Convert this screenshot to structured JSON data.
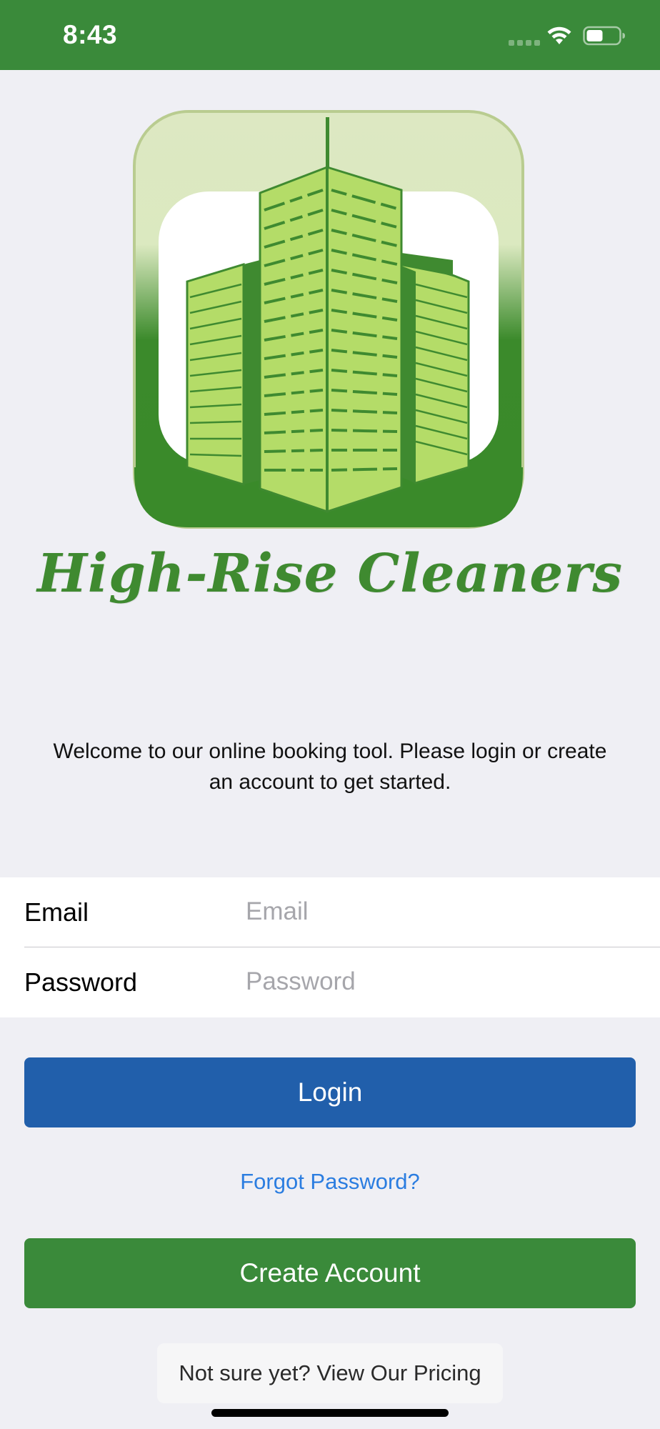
{
  "status_bar": {
    "time": "8:43",
    "background_color": "#3a8a3a"
  },
  "brand": {
    "name": "High-Rise Cleaners",
    "logo_icon": "buildings-logo-icon",
    "color": "#3f8a30"
  },
  "welcome": {
    "message": "Welcome to our online booking tool. Please login or create an account to get started."
  },
  "form": {
    "email": {
      "label": "Email",
      "placeholder": "Email",
      "value": ""
    },
    "password": {
      "label": "Password",
      "placeholder": "Password",
      "value": ""
    }
  },
  "actions": {
    "login_label": "Login",
    "login_color": "#215fab",
    "forgot_label": "Forgot Password?",
    "create_label": "Create Account",
    "create_color": "#3a8a3a",
    "pricing_label": "Not sure yet? View Our Pricing"
  }
}
